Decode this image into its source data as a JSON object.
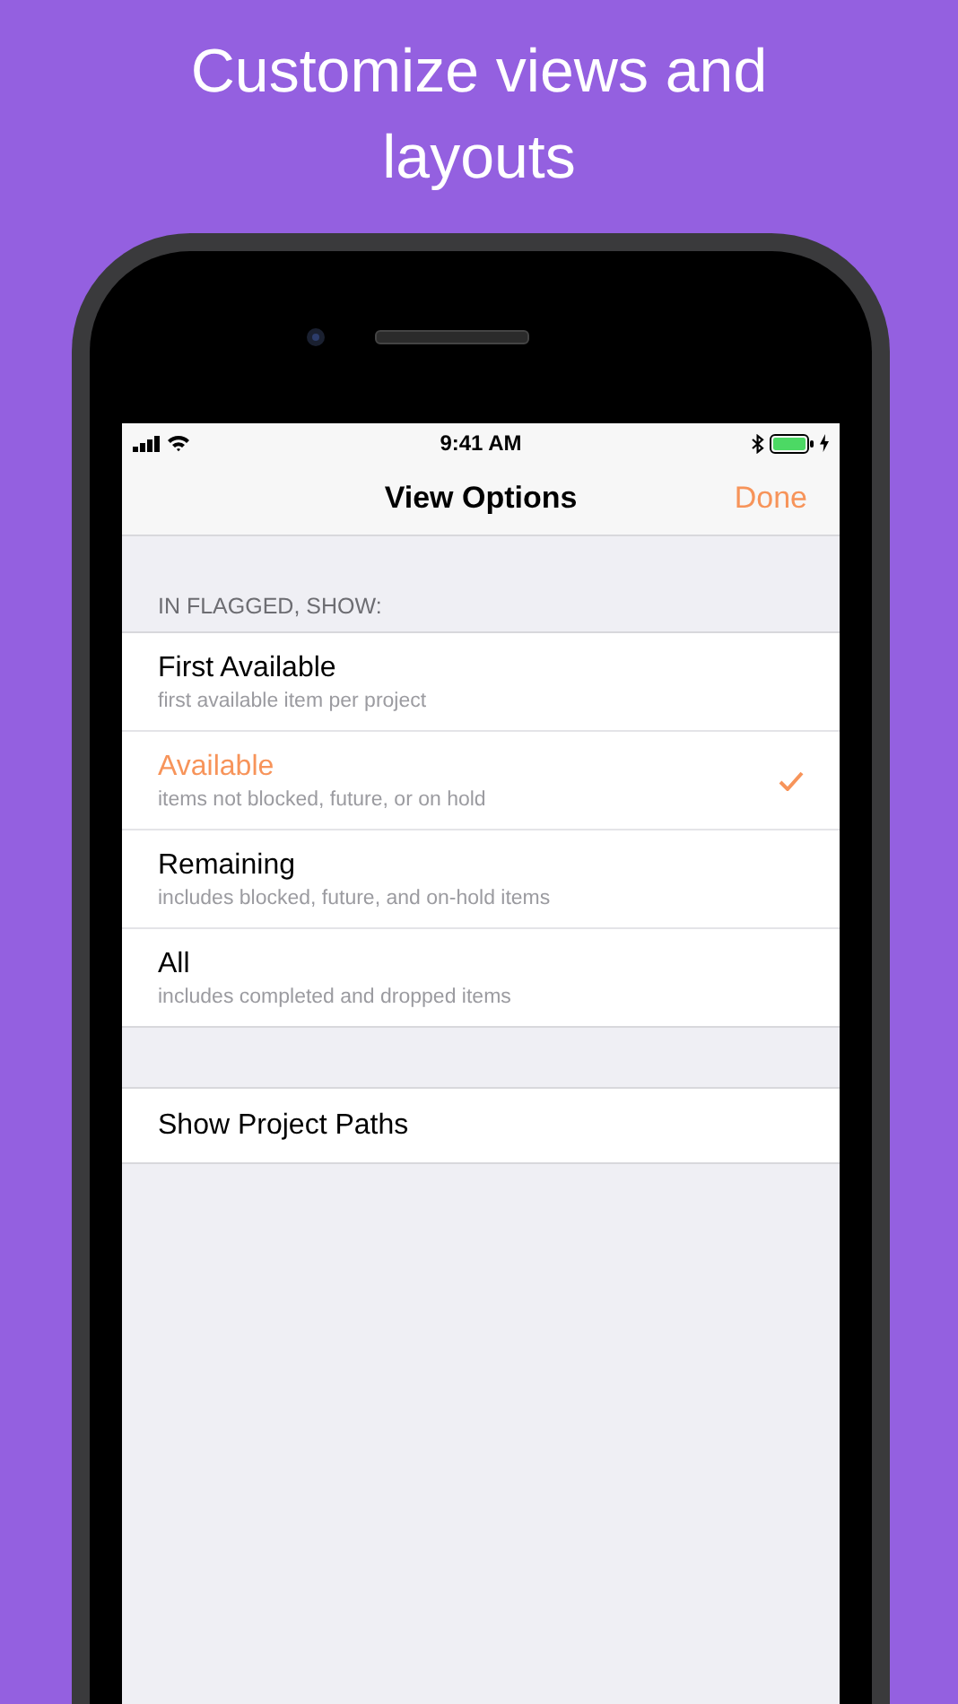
{
  "headline": "Customize views and layouts",
  "status_bar": {
    "time": "9:41 AM"
  },
  "nav_bar": {
    "title": "View Options",
    "done": "Done"
  },
  "section_header": "IN FLAGGED, SHOW:",
  "options": [
    {
      "title": "First Available",
      "subtitle": "first available item per project",
      "selected": false
    },
    {
      "title": "Available",
      "subtitle": "items not blocked, future, or on hold",
      "selected": true
    },
    {
      "title": "Remaining",
      "subtitle": "includes blocked, future, and on-hold items",
      "selected": false
    },
    {
      "title": "All",
      "subtitle": "includes completed and dropped items",
      "selected": false
    }
  ],
  "settings": [
    {
      "label": "Show Project Paths"
    }
  ]
}
